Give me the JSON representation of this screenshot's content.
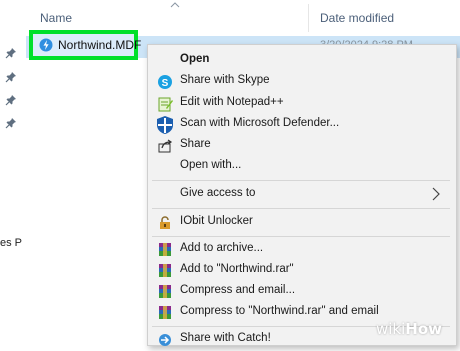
{
  "columns": {
    "name": "Name",
    "date_modified": "Date modified"
  },
  "file": {
    "name": "Northwind.MDF",
    "date_modified": "3/20/2024 9:28 PM"
  },
  "sidebar_partial_text": "es P",
  "context_menu": {
    "items": [
      {
        "label": "Open",
        "icon": "none",
        "bold": true
      },
      {
        "label": "Share with Skype",
        "icon": "skype-icon"
      },
      {
        "label": "Edit with Notepad++",
        "icon": "notepad-plus-plus-icon"
      },
      {
        "label": "Scan with Microsoft Defender...",
        "icon": "defender-shield-icon"
      },
      {
        "label": "Share",
        "icon": "share-icon"
      },
      {
        "label": "Open with...",
        "icon": "none"
      },
      {
        "label": "Give access to",
        "icon": "none",
        "submenu": true
      },
      {
        "label": "IObit Unlocker",
        "icon": "lock-icon"
      },
      {
        "label": "Add to archive...",
        "icon": "winrar-icon"
      },
      {
        "label": "Add to \"Northwind.rar\"",
        "icon": "winrar-icon"
      },
      {
        "label": "Compress and email...",
        "icon": "winrar-icon"
      },
      {
        "label": "Compress to \"Northwind.rar\" and email",
        "icon": "winrar-icon"
      },
      {
        "label": "Share with Catch!",
        "icon": "catch-icon"
      }
    ]
  },
  "watermark": {
    "prefix": "wiki",
    "suffix": "How"
  },
  "colors": {
    "highlight": "#00e02a",
    "selection": "#cce4f7",
    "menu_bg": "#f2f2f2"
  }
}
